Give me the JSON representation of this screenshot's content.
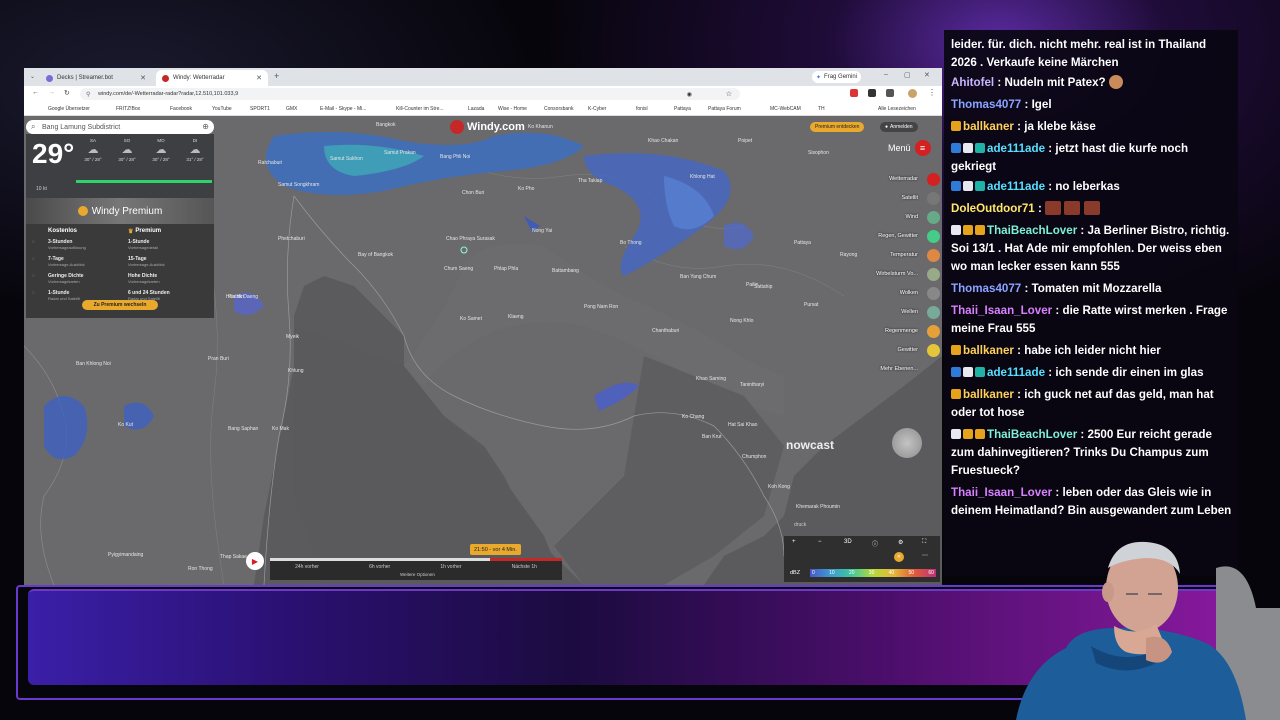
{
  "browser": {
    "tabs": [
      {
        "label": "Decks | Streamer.bot",
        "active": false
      },
      {
        "label": "Windy: Wetterradar",
        "active": true
      }
    ],
    "new_tab": "+",
    "top_right": "Frag Gemini",
    "url": "windy.com/de/-Wetterradar-radar?radar,12.510,101.033,9",
    "bookmarks": [
      "Google Übersetzer",
      "FRITZ!Box",
      "Facebook",
      "YouTube",
      "SPORT1",
      "GMX",
      "E-Mail - Skype - Mi...",
      "Kill-Counter im Stre...",
      "Lazada",
      "Wise - Home",
      "Consorsbank",
      "K-Cyber",
      "fonisl",
      "Pattaya",
      "Pattaya Forum",
      "MC-WebCAM",
      "TH",
      "Alle Lesezeichen"
    ]
  },
  "windy": {
    "search_placeholder": "Bang Lamung Subdistrict",
    "temperature": "29°",
    "forecast_days": [
      {
        "day": "SA",
        "temp": "30° / 28°"
      },
      {
        "day": "SO",
        "temp": "30° / 28°"
      },
      {
        "day": "MO",
        "temp": "30° / 28°"
      },
      {
        "day": "DI",
        "temp": "31° / 28°"
      }
    ],
    "wind_label": "10 kt",
    "premium_title": "Windy Premium",
    "plan_free": "Kostenlos",
    "plan_premium": "Premium",
    "compare_rows": [
      {
        "free": "3-Stunden",
        "free_sub": "Vorhersageauflösung",
        "premium": "1-Stunde",
        "premium_sub": "Vorhersagedetail"
      },
      {
        "free": "7-Tage",
        "free_sub": "Vorhersage-Ausblick",
        "premium": "15-Tage",
        "premium_sub": "Vorhersage-Ausblick"
      },
      {
        "free": "Geringe Dichte",
        "free_sub": "Vorhersagekarten",
        "premium": "Hohe Dichte",
        "premium_sub": "Vorhersagekarten"
      },
      {
        "free": "1-Stunde",
        "free_sub": "Radar und Satellit",
        "premium": "6 und 24 Stunden",
        "premium_sub": "Radar und Satellit"
      }
    ],
    "premium_cta": "Zu Premium wechseln",
    "logo": "Windy.com",
    "premium_btn": "Premium entdecken",
    "login_btn": "Anmelden",
    "menu": "Menü",
    "layers": [
      "Wetterradar",
      "Satellit",
      "Wind",
      "Regen, Gewitter",
      "Temperatur",
      "Wirbelsturm Vo...",
      "Wolken",
      "Wellen",
      "Regenmenge",
      "Gewitter",
      "Mehr Ebenen..."
    ],
    "places": [
      {
        "name": "Bangkok"
      },
      {
        "name": "Ko Khanun"
      },
      {
        "name": "Ratchaburi"
      },
      {
        "name": "Samut Sakhon"
      },
      {
        "name": "Samut Prakan"
      },
      {
        "name": "Bang Phli Noi"
      },
      {
        "name": "Khao Chakan"
      },
      {
        "name": "Poipet"
      },
      {
        "name": "Sisophon"
      },
      {
        "name": "Samut Songkhram"
      },
      {
        "name": "Chon Buri"
      },
      {
        "name": "Ko Pho"
      },
      {
        "name": "Tha Takiap"
      },
      {
        "name": "Khlong Hat"
      },
      {
        "name": "Phetchaburi"
      },
      {
        "name": "Bay of Bangkok"
      },
      {
        "name": "Chao Phraya Surasak"
      },
      {
        "name": "Nong Yai"
      },
      {
        "name": "Bo Thong"
      },
      {
        "name": "Pattaya"
      },
      {
        "name": "Plutak Daeng"
      },
      {
        "name": "Chum Saeng"
      },
      {
        "name": "Phlap Phla"
      },
      {
        "name": "Battambang"
      },
      {
        "name": "Ban Yang Chum"
      },
      {
        "name": "Sattahip"
      },
      {
        "name": "Rayong"
      },
      {
        "name": "Klaeng"
      },
      {
        "name": "Pong Nam Ron"
      },
      {
        "name": "Pailin"
      },
      {
        "name": "Hua Hin"
      },
      {
        "name": "Ko Samet"
      },
      {
        "name": "Chanthaburi"
      },
      {
        "name": "Nong Khlo"
      },
      {
        "name": "Pursat"
      },
      {
        "name": "Myeik"
      },
      {
        "name": "Ban Khlong Noi"
      },
      {
        "name": "Pran Buri"
      },
      {
        "name": "Khlung"
      },
      {
        "name": "Khao Saming"
      },
      {
        "name": "Tanintharyi"
      },
      {
        "name": "Ko Kut"
      },
      {
        "name": "Bang Saphan"
      },
      {
        "name": "Hat Sai Khao"
      },
      {
        "name": "Ko Chang"
      },
      {
        "name": "Ban Krut"
      },
      {
        "name": "Ko Mak"
      },
      {
        "name": "Chumphon"
      },
      {
        "name": "Koh Kong"
      },
      {
        "name": "Khemarak Phoumin"
      },
      {
        "name": "Pyigyimandaing"
      },
      {
        "name": "Ron Thong"
      },
      {
        "name": "Thap Sakae"
      }
    ],
    "nowcast": "nowcast",
    "timeline_time": "21:50 - vor 4 Min.",
    "timeline_labels": [
      "24h vorher",
      "6h vorher",
      "1h vorher",
      "Nächste 1h"
    ],
    "timeline_sub": "Weitere Optionen",
    "bottom_right_labels": [
      "3D",
      "dBZ"
    ],
    "dbz_scale": [
      "0",
      "10",
      "20",
      "30",
      "40",
      "50",
      "60"
    ],
    "check_label": "druck"
  },
  "chat": {
    "messages": [
      {
        "nick": "",
        "color": "#ffffff",
        "text": "leider. für. dich. nicht mehr. real ist in Thailand 2026 . Verkaufe keine Märchen",
        "badges": []
      },
      {
        "nick": "Ahitofel",
        "color": "#c8b6ff",
        "text": "Nudeln mit Patex?",
        "badges": []
      },
      {
        "nick": "Thomas4077",
        "color": "#8aa4ff",
        "text": "Igel",
        "badges": []
      },
      {
        "nick": "ballkaner",
        "color": "#ffd15a",
        "text": "ja klebe käse",
        "badges": [
          "gold"
        ]
      },
      {
        "nick": "ade111ade",
        "color": "#55e0ff",
        "text": "jetzt hast die kurfe noch gekriegt",
        "badges": [
          "blue",
          "flag",
          "teal"
        ]
      },
      {
        "nick": "ade111ade",
        "color": "#55e0ff",
        "text": "no leberkas",
        "badges": [
          "blue",
          "flag",
          "teal"
        ]
      },
      {
        "nick": "DoleOutdoor71",
        "color": "#ffe86a",
        "text": "",
        "badges": []
      },
      {
        "nick": "ThaiBeachLover",
        "color": "#7ef0d8",
        "text": "Ja Berliner Bistro, richtig. Soi 13/1 . Hat Ade mir empfohlen. Der weiss eben wo man lecker essen kann 555",
        "badges": [
          "flag",
          "gold",
          "gold"
        ]
      },
      {
        "nick": "Thomas4077",
        "color": "#8aa4ff",
        "text": "Tomaten mit Mozzarella",
        "badges": []
      },
      {
        "nick": "Thaii_Isaan_Lover",
        "color": "#d880ff",
        "text": "die Ratte wirst merken . Frage meine Frau 555",
        "badges": []
      },
      {
        "nick": "ballkaner",
        "color": "#ffd15a",
        "text": "habe ich leider nicht hier",
        "badges": [
          "gold"
        ]
      },
      {
        "nick": "ade111ade",
        "color": "#55e0ff",
        "text": "ich sende dir einen im glas",
        "badges": [
          "blue",
          "flag",
          "teal"
        ]
      },
      {
        "nick": "ballkaner",
        "color": "#ffd15a",
        "text": "ich guck net auf das geld, man hat oder tot hose",
        "badges": [
          "gold"
        ]
      },
      {
        "nick": "ThaiBeachLover",
        "color": "#7ef0d8",
        "text": "2500 Eur reicht gerade zum dahinvegitieren? Trinks Du Champus zum Fruestueck?",
        "badges": [
          "flag",
          "gold",
          "gold"
        ]
      },
      {
        "nick": "Thaii_Isaan_Lover",
        "color": "#d880ff",
        "text": "leben oder das Gleis wie in deinem Heimatland? Bin ausgewandert zum Leben",
        "badges": []
      }
    ]
  }
}
